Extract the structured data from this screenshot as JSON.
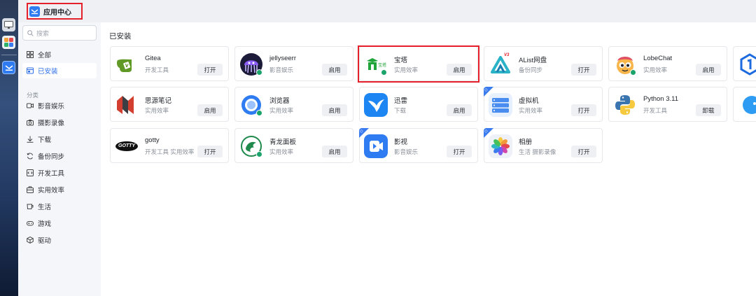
{
  "window": {
    "title": "应用中心"
  },
  "search": {
    "placeholder": "搜索"
  },
  "sidebar": {
    "items": [
      {
        "label": "全部",
        "icon": "grid-icon"
      },
      {
        "label": "已安装",
        "icon": "installed-icon",
        "active": true
      }
    ],
    "section_label": "分类",
    "categories": [
      {
        "label": "影音娱乐",
        "icon": "video-icon"
      },
      {
        "label": "摄影录像",
        "icon": "camera-icon"
      },
      {
        "label": "下载",
        "icon": "download-icon"
      },
      {
        "label": "备份同步",
        "icon": "sync-icon"
      },
      {
        "label": "开发工具",
        "icon": "code-icon"
      },
      {
        "label": "实用效率",
        "icon": "briefcase-icon"
      },
      {
        "label": "生活",
        "icon": "cup-icon"
      },
      {
        "label": "游戏",
        "icon": "gamepad-icon"
      },
      {
        "label": "驱动",
        "icon": "cube-icon"
      }
    ]
  },
  "main": {
    "heading": "已安装",
    "apps": [
      {
        "name": "Gitea",
        "category": "开发工具",
        "action": "打开",
        "icon": "gitea-icon"
      },
      {
        "name": "jellyseerr",
        "category": "影音娱乐",
        "action": "启用",
        "icon": "jellyseerr-icon"
      },
      {
        "name": "宝塔",
        "category": "实用效率",
        "action": "启用",
        "icon": "baota-icon",
        "highlighted": true
      },
      {
        "name": "AList网盘",
        "category": "备份同步",
        "action": "打开",
        "icon": "alist-icon"
      },
      {
        "name": "LobeChat",
        "category": "实用效率",
        "action": "启用",
        "icon": "lobechat-icon"
      },
      {
        "name": "思源笔记",
        "category": "实用效率",
        "action": "启用",
        "icon": "siyuan-icon"
      },
      {
        "name": "浏览器",
        "category": "实用效率",
        "action": "启用",
        "icon": "browser-icon"
      },
      {
        "name": "迅雷",
        "category": "下载",
        "action": "启用",
        "icon": "thunder-icon"
      },
      {
        "name": "虚拟机",
        "category": "实用效率",
        "action": "打开",
        "icon": "vm-icon"
      },
      {
        "name": "Python 3.11",
        "category": "开发工具",
        "action": "卸载",
        "icon": "python-icon"
      },
      {
        "name": "gotty",
        "category": "开发工具 实用效率",
        "action": "打开",
        "icon": "gotty-icon"
      },
      {
        "name": "青龙面板",
        "category": "实用效率",
        "action": "启用",
        "icon": "qinglong-icon"
      },
      {
        "name": "影视",
        "category": "影音娱乐",
        "action": "打开",
        "icon": "video-app-icon"
      },
      {
        "name": "相册",
        "category": "生活 摄影录像",
        "action": "打开",
        "icon": "photos-icon"
      }
    ],
    "corner_badge": "◇",
    "alist_badge": "V3",
    "baota_icon_text": "宝塔",
    "gotty_icon_text": "GOTTY"
  },
  "colors": {
    "accent": "#2f6fe8",
    "highlight": "#e5202a",
    "corner": "#3b7bf0"
  }
}
